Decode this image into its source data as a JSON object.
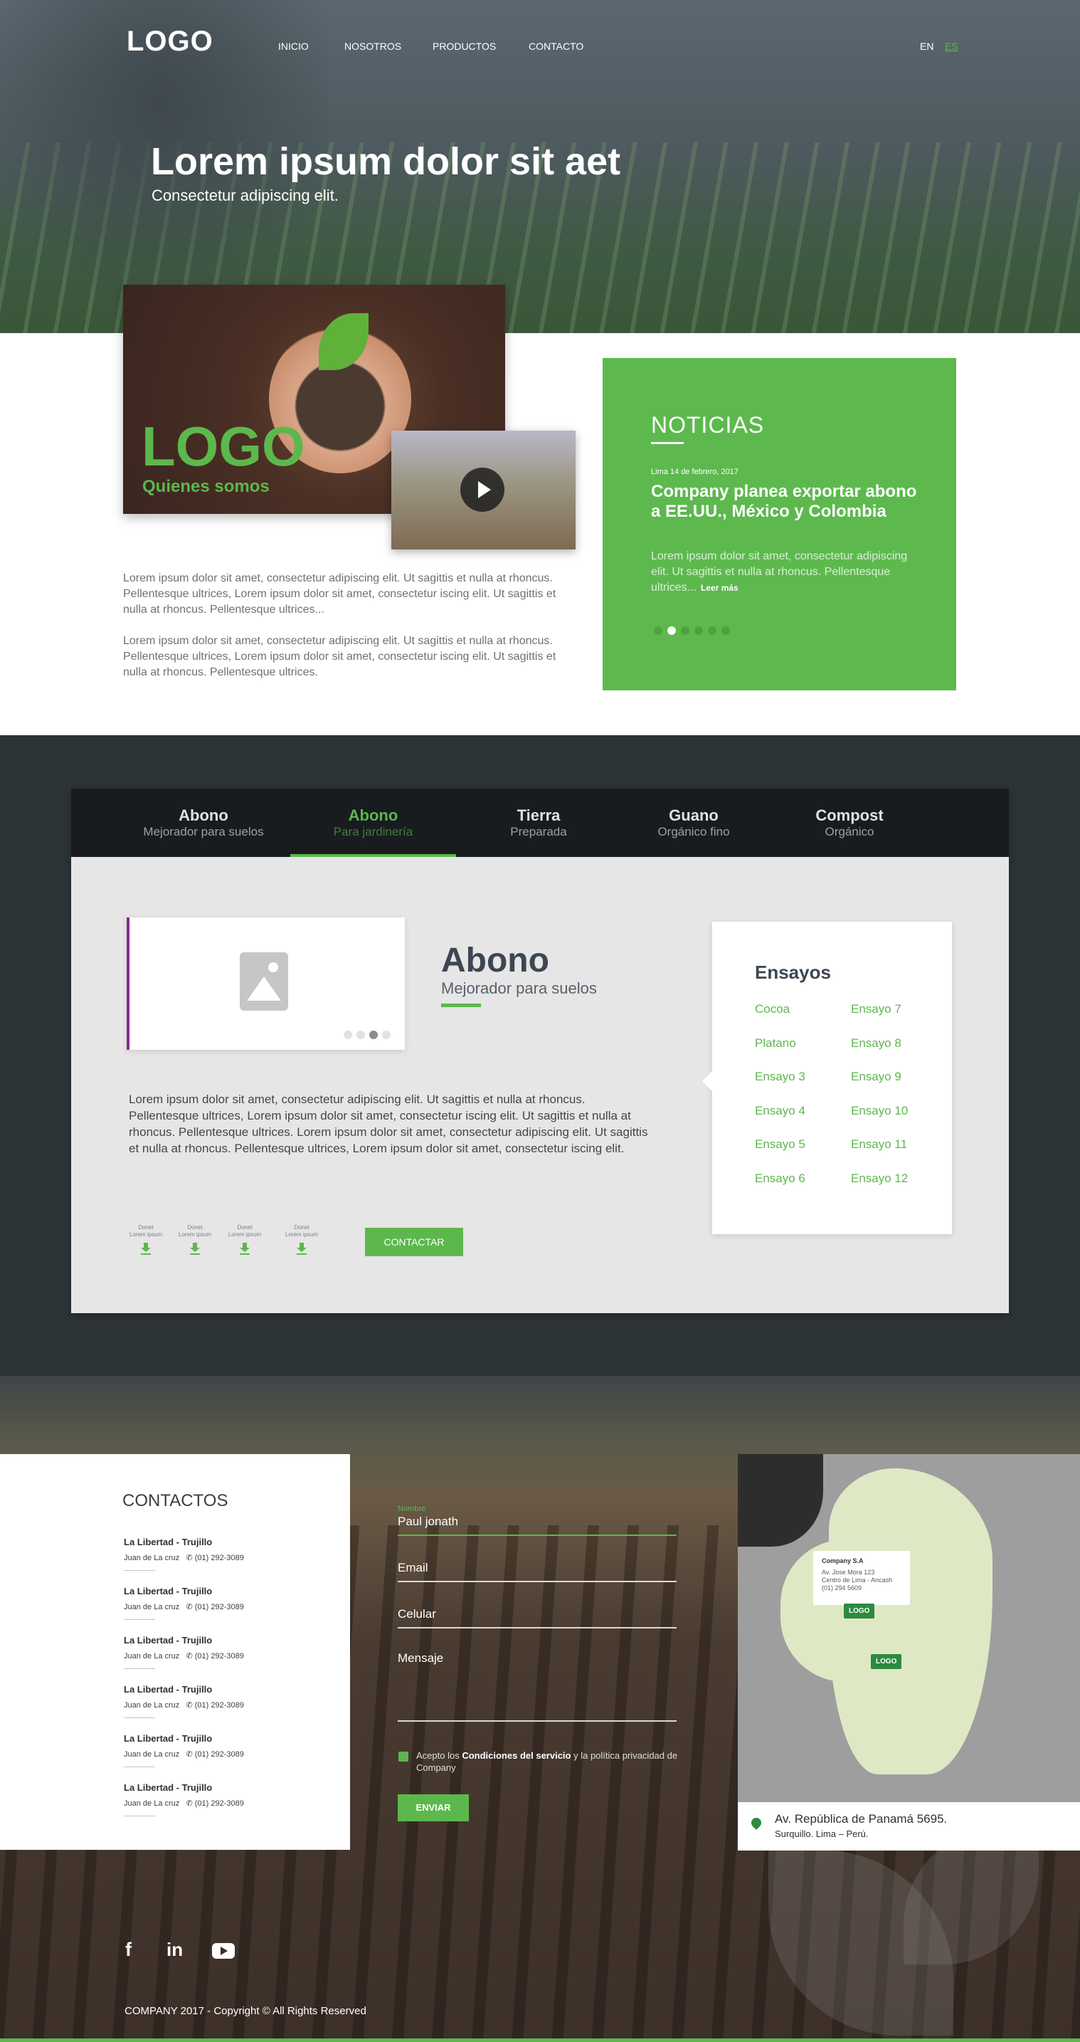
{
  "header": {
    "logo": "LOGO",
    "nav": [
      "INICIO",
      "NOSOTROS",
      "PRODUCTOS",
      "CONTACTO"
    ],
    "lang_en": "EN",
    "lang_es": "ES",
    "accent": "#5cb84c"
  },
  "hero": {
    "title": "Lorem ipsum dolor sit aet",
    "subtitle": "Consectetur adipiscing elit."
  },
  "about": {
    "logo": "LOGO",
    "subtitle": "Quienes somos",
    "p1": "Lorem ipsum dolor sit amet, consectetur adipiscing elit. Ut sagittis et nulla at rhoncus. Pellentesque ultrices, Lorem ipsum dolor sit amet, consectetur iscing elit. Ut sagittis et nulla at rhoncus. Pellentesque ultrices...",
    "p2": "Lorem ipsum dolor sit amet, consectetur adipiscing elit. Ut sagittis et nulla at rhoncus. Pellentesque ultrices, Lorem ipsum dolor sit amet, consectetur iscing elit. Ut sagittis et nulla at rhoncus. Pellentesque ultrices."
  },
  "news": {
    "heading": "NOTICIAS",
    "date": "Lima 14 de febrero, 2017",
    "title": "Company planea exportar abono a EE.UU., México y Colombia",
    "body": "Lorem ipsum dolor sit amet, consectetur adipiscing elit. Ut sagittis et nulla at rhoncus. Pellentesque ultrices...",
    "more": "Leer más",
    "slides_total": 6,
    "slide_active": 2
  },
  "products": {
    "tabs": [
      {
        "title": "Abono",
        "sub": "Mejorador para suelos"
      },
      {
        "title": "Abono",
        "sub": "Para jardinería"
      },
      {
        "title": "Tierra",
        "sub": "Preparada"
      },
      {
        "title": "Guano",
        "sub": "Orgánico fino"
      },
      {
        "title": "Compost",
        "sub": "Orgánico"
      }
    ],
    "active_tab": 2,
    "title": "Abono",
    "subtitle": "Mejorador para suelos",
    "text": "Lorem ipsum dolor sit amet, consectetur adipiscing elit. Ut sagittis et nulla at rhoncus. Pellentesque ultrices, Lorem ipsum dolor sit amet, consectetur iscing elit. Ut sagittis et nulla at rhoncus. Pellentesque ultrices. Lorem ipsum dolor sit amet, consectetur adipiscing elit. Ut sagittis et nulla at rhoncus. Pellentesque ultrices, Lorem ipsum dolor sit amet, consectetur iscing elit.",
    "gallery_dots_total": 4,
    "gallery_dot_active": 3,
    "downloads": [
      {
        "line1": "Donet",
        "line2": "Lorem ipsum"
      },
      {
        "line1": "Donet",
        "line2": "Lorem ipsum"
      },
      {
        "line1": "Donet",
        "line2": "Lorem ipsum"
      },
      {
        "line1": "Donet",
        "line2": "Lorem ipsum"
      }
    ],
    "contact_button": "CONTACTAR",
    "ensayos_heading": "Ensayos",
    "ensayos": [
      "Cocoa",
      "Ensayo 7",
      "Platano",
      "Ensayo 8",
      "Ensayo 3",
      "Ensayo 9",
      "Ensayo 4",
      "Ensayo 10",
      "Ensayo 5",
      "Ensayo 11",
      "Ensayo 6",
      "Ensayo 12"
    ]
  },
  "contact": {
    "heading": "CONTACTOS",
    "offices": [
      {
        "city": "La Libertad - Trujillo",
        "name": "Juan de La cruz",
        "phone": "(01) 292-3089"
      },
      {
        "city": "La Libertad - Trujillo",
        "name": "Juan de La cruz",
        "phone": "(01) 292-3089"
      },
      {
        "city": "La Libertad - Trujillo",
        "name": "Juan de La cruz",
        "phone": "(01) 292-3089"
      },
      {
        "city": "La Libertad - Trujillo",
        "name": "Juan de La cruz",
        "phone": "(01) 292-3089"
      },
      {
        "city": "La Libertad - Trujillo",
        "name": "Juan de La cruz",
        "phone": "(01) 292-3089"
      },
      {
        "city": "La Libertad - Trujillo",
        "name": "Juan de La cruz",
        "phone": "(01) 292-3089"
      }
    ],
    "form": {
      "name_label": "Nombre",
      "name_value": "Paul jonath",
      "email_placeholder": "Email",
      "phone_placeholder": "Celular",
      "message_placeholder": "Mensaje",
      "terms_pre": "Acepto los",
      "terms_link": "Condiciones del servicio",
      "terms_post": "y la política privacidad de Company",
      "submit": "ENVIAR"
    },
    "map": {
      "popup_title": "Company S.A",
      "popup_l1": "Av. Jose Mora 123",
      "popup_l2": "Centro de Lima - Ancash",
      "popup_l3": "(01) 294 5609",
      "pin1": "LOGO",
      "pin2": "LOGO",
      "address": "Av. República de Panamá 5695.",
      "address2": "Surquillo. Lima – Perú."
    }
  },
  "footer": {
    "social": [
      "facebook-icon",
      "linkedin-icon",
      "youtube-icon"
    ],
    "copyright": "COMPANY 2017 - Copyright © All Rights Reserved"
  }
}
